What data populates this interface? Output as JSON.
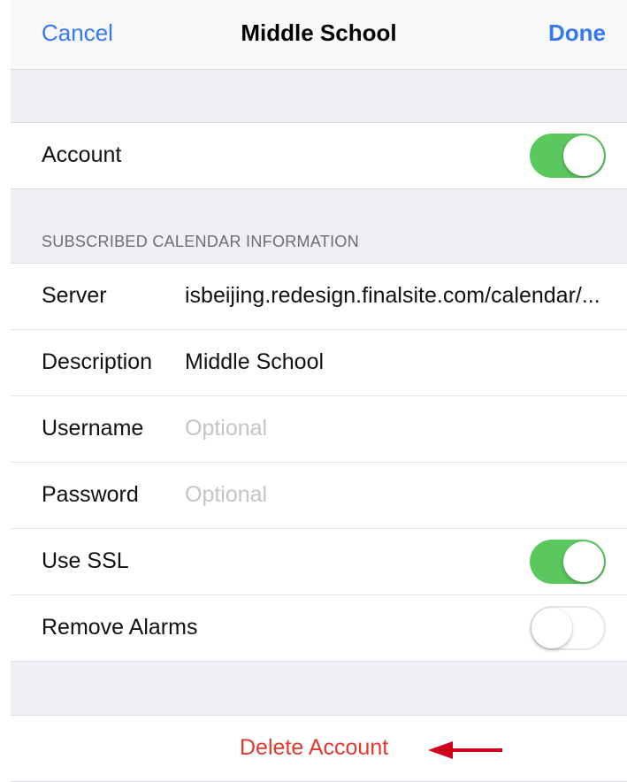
{
  "nav": {
    "cancel_label": "Cancel",
    "title": "Middle School",
    "done_label": "Done"
  },
  "account": {
    "label": "Account",
    "toggle_on": true
  },
  "section_header": "SUBSCRIBED CALENDAR INFORMATION",
  "fields": {
    "server": {
      "label": "Server",
      "value": "isbeijing.redesign.finalsite.com/calendar/..."
    },
    "description": {
      "label": "Description",
      "value": "Middle School"
    },
    "username": {
      "label": "Username",
      "placeholder": "Optional"
    },
    "password": {
      "label": "Password",
      "placeholder": "Optional"
    }
  },
  "use_ssl": {
    "label": "Use SSL",
    "toggle_on": true
  },
  "remove_alarms": {
    "label": "Remove Alarms",
    "toggle_on": false
  },
  "delete_label": "Delete Account",
  "colors": {
    "accent_blue": "#3478f6",
    "toggle_green": "#5ac85f",
    "destructive_red": "#e03a2f",
    "annotation_arrow": "#d0021b"
  }
}
